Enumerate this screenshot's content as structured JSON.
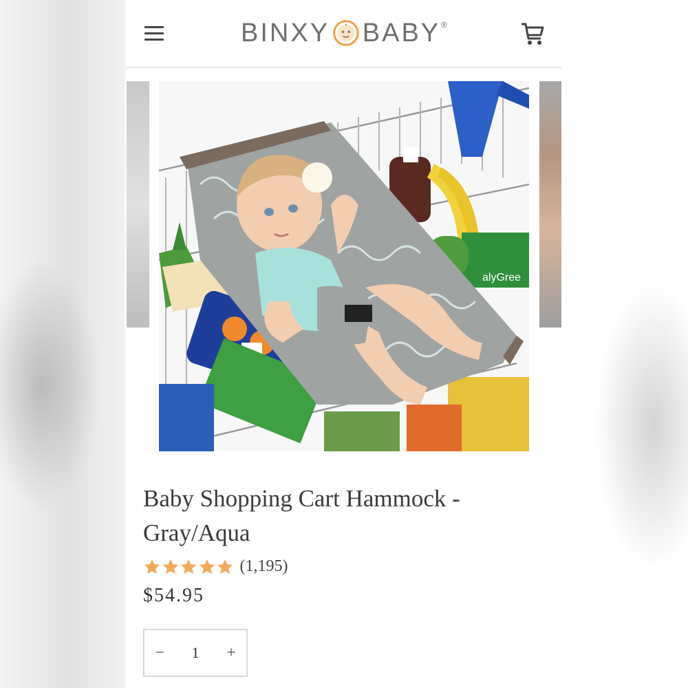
{
  "header": {
    "logo_left": "BINXY",
    "logo_right": "BABY",
    "logo_mark": "®",
    "menu_icon": "hamburger-menu-icon",
    "cart_icon": "shopping-cart-icon"
  },
  "gallery": {
    "main_image": "baby in gray/aqua hammock inside shopping cart with groceries",
    "prev_image": "partial product image",
    "next_image": "partial product image"
  },
  "product": {
    "title": "Baby Shopping Cart Hammock - Gray/Aqua",
    "rating_count": "(1,195)",
    "rating_stars": 5,
    "price": "$54.95"
  },
  "quantity": {
    "minus": "−",
    "value": "1",
    "plus": "+"
  },
  "colors": {
    "star": "#f4a95a",
    "text": "#3b3b3b",
    "logo": "#6f6f6f",
    "logo_ring": "#f0a140"
  }
}
